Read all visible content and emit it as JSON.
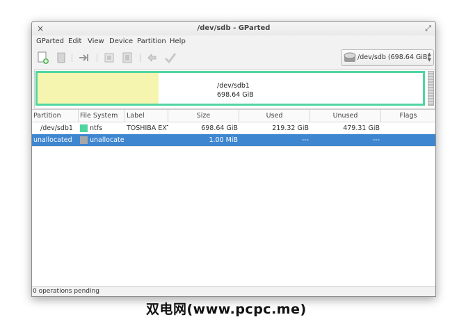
{
  "window": {
    "title": "/dev/sdb - GParted",
    "close_glyph": "×",
    "maximize_glyph": "⤢"
  },
  "menu": [
    "GParted",
    "Edit",
    "View",
    "Device",
    "Partition",
    "Help"
  ],
  "toolbar": {
    "icons": [
      "new-partition-icon",
      "delete-partition-icon",
      "resize-move-icon",
      "copy-icon",
      "paste-icon",
      "undo-icon",
      "apply-icon"
    ],
    "device_selector": {
      "label": "/dev/sdb   (698.64 GiB)",
      "icon": "harddisk-icon"
    }
  },
  "disk_map": {
    "partition_name": "/dev/sdb1",
    "partition_size": "698.64 GiB",
    "used_fraction": 0.314,
    "colors": {
      "border": "#4fd6a0",
      "used": "#f5f5b0",
      "unallocated": "#bdbdbd"
    }
  },
  "table": {
    "headers": [
      "Partition",
      "File System",
      "Label",
      "Size",
      "Used",
      "Unused",
      "Flags"
    ],
    "rows": [
      {
        "partition": "/dev/sdb1",
        "filesystem": "ntfs",
        "fs_color": "#4fd6a0",
        "label": "TOSHIBA EXT",
        "size": "698.64 GiB",
        "used": "219.32 GiB",
        "unused": "479.31 GiB",
        "flags": ""
      },
      {
        "partition": "unallocated",
        "filesystem": "unallocated",
        "fs_color": "#a8a8a8",
        "label": "",
        "size": "1.00 MiB",
        "used": "---",
        "unused": "---",
        "flags": ""
      }
    ]
  },
  "status": {
    "text": "0 operations pending"
  },
  "watermark": "双电网(www.pcpc.me)"
}
